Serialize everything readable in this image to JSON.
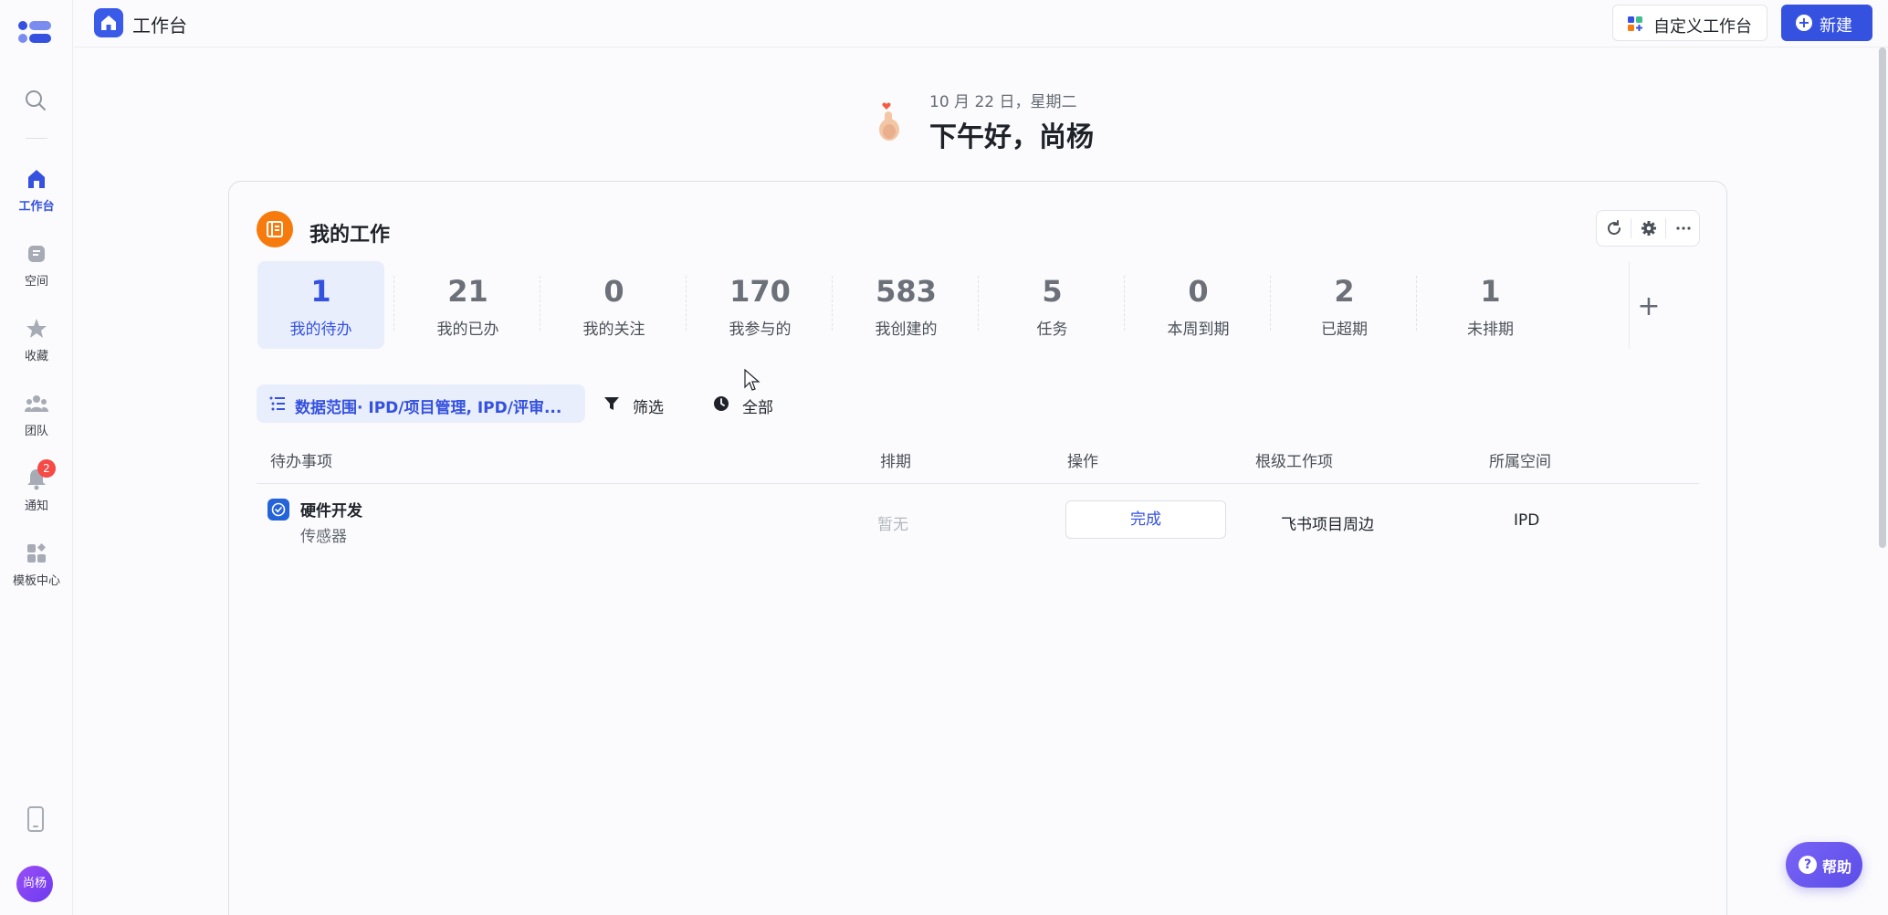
{
  "sidebar": {
    "items": [
      {
        "label": "工作台",
        "icon": "home-icon"
      },
      {
        "label": "空间",
        "icon": "space-icon"
      },
      {
        "label": "收藏",
        "icon": "star-icon"
      },
      {
        "label": "团队",
        "icon": "team-icon"
      },
      {
        "label": "通知",
        "icon": "bell-icon",
        "badge": "2"
      },
      {
        "label": "模板中心",
        "icon": "template-icon"
      }
    ],
    "avatar": "尚杨"
  },
  "topbar": {
    "title": "工作台",
    "customize_label": "自定义工作台",
    "new_label": "新建"
  },
  "greeting": {
    "date": "10 月 22 日，星期二",
    "message": "下午好，尚杨"
  },
  "card": {
    "title": "我的工作",
    "stats": [
      {
        "value": "1",
        "label": "我的待办"
      },
      {
        "value": "21",
        "label": "我的已办"
      },
      {
        "value": "0",
        "label": "我的关注"
      },
      {
        "value": "170",
        "label": "我参与的"
      },
      {
        "value": "583",
        "label": "我创建的"
      },
      {
        "value": "5",
        "label": "任务"
      },
      {
        "value": "0",
        "label": "本周到期"
      },
      {
        "value": "2",
        "label": "已超期"
      },
      {
        "value": "1",
        "label": "未排期"
      }
    ],
    "add_label": "+",
    "scope_label": "数据范围· IPD/项目管理, IPD/评审...",
    "filter_label": "筛选",
    "all_label": "全部",
    "table": {
      "headers": [
        "待办事项",
        "排期",
        "操作",
        "根级工作项",
        "所属空间"
      ],
      "rows": [
        {
          "name": "硬件开发",
          "sub": "传感器",
          "schedule": "暂无",
          "action": "完成",
          "root": "飞书项目周边",
          "space": "IPD"
        }
      ]
    }
  },
  "help": {
    "label": "帮助",
    "icon_text": "?"
  },
  "colors": {
    "accent": "#3451e0",
    "card_icon": "#f77a0d",
    "badge": "#f54a45"
  }
}
